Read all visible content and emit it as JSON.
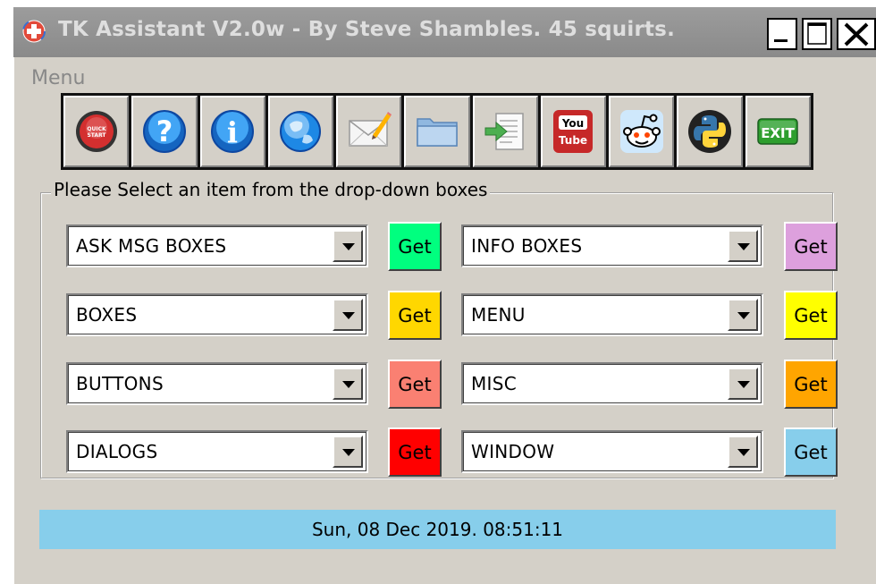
{
  "window": {
    "title": "TK Assistant V2.0w - By Steve Shambles. 45 squirts.",
    "menu_label": "Menu"
  },
  "toolbar": {
    "buttons": [
      {
        "name": "quick-start",
        "icon": "quick-start-icon",
        "label": "QUICK START"
      },
      {
        "name": "help",
        "icon": "question-icon",
        "label": "?"
      },
      {
        "name": "info",
        "icon": "info-icon",
        "label": "i"
      },
      {
        "name": "web",
        "icon": "globe-icon"
      },
      {
        "name": "email",
        "icon": "envelope-pencil-icon"
      },
      {
        "name": "folder",
        "icon": "folder-icon"
      },
      {
        "name": "export",
        "icon": "document-arrow-icon"
      },
      {
        "name": "youtube",
        "icon": "youtube-icon",
        "label_top": "You",
        "label_bottom": "Tube"
      },
      {
        "name": "reddit",
        "icon": "reddit-icon"
      },
      {
        "name": "python",
        "icon": "python-icon"
      },
      {
        "name": "exit",
        "icon": "exit-icon",
        "label": "EXIT"
      }
    ]
  },
  "group": {
    "label": "Please Select an item from the drop-down boxes",
    "left": [
      {
        "value": "ASK MSG BOXES",
        "button": "Get",
        "color": "#00ff7f"
      },
      {
        "value": "BOXES",
        "button": "Get",
        "color": "#ffd700"
      },
      {
        "value": "BUTTONS",
        "button": "Get",
        "color": "#fa8072"
      },
      {
        "value": "DIALOGS",
        "button": "Get",
        "color": "#ff0000"
      }
    ],
    "right": [
      {
        "value": "INFO BOXES",
        "button": "Get",
        "color": "#dda0dd"
      },
      {
        "value": "MENU",
        "button": "Get",
        "color": "#ffff00"
      },
      {
        "value": "MISC",
        "button": "Get",
        "color": "#ffa500"
      },
      {
        "value": "WINDOW",
        "button": "Get",
        "color": "#87ceeb"
      }
    ]
  },
  "status": {
    "datetime": "Sun, 08 Dec 2019. 08:51:11",
    "color": "#87ceeb"
  }
}
